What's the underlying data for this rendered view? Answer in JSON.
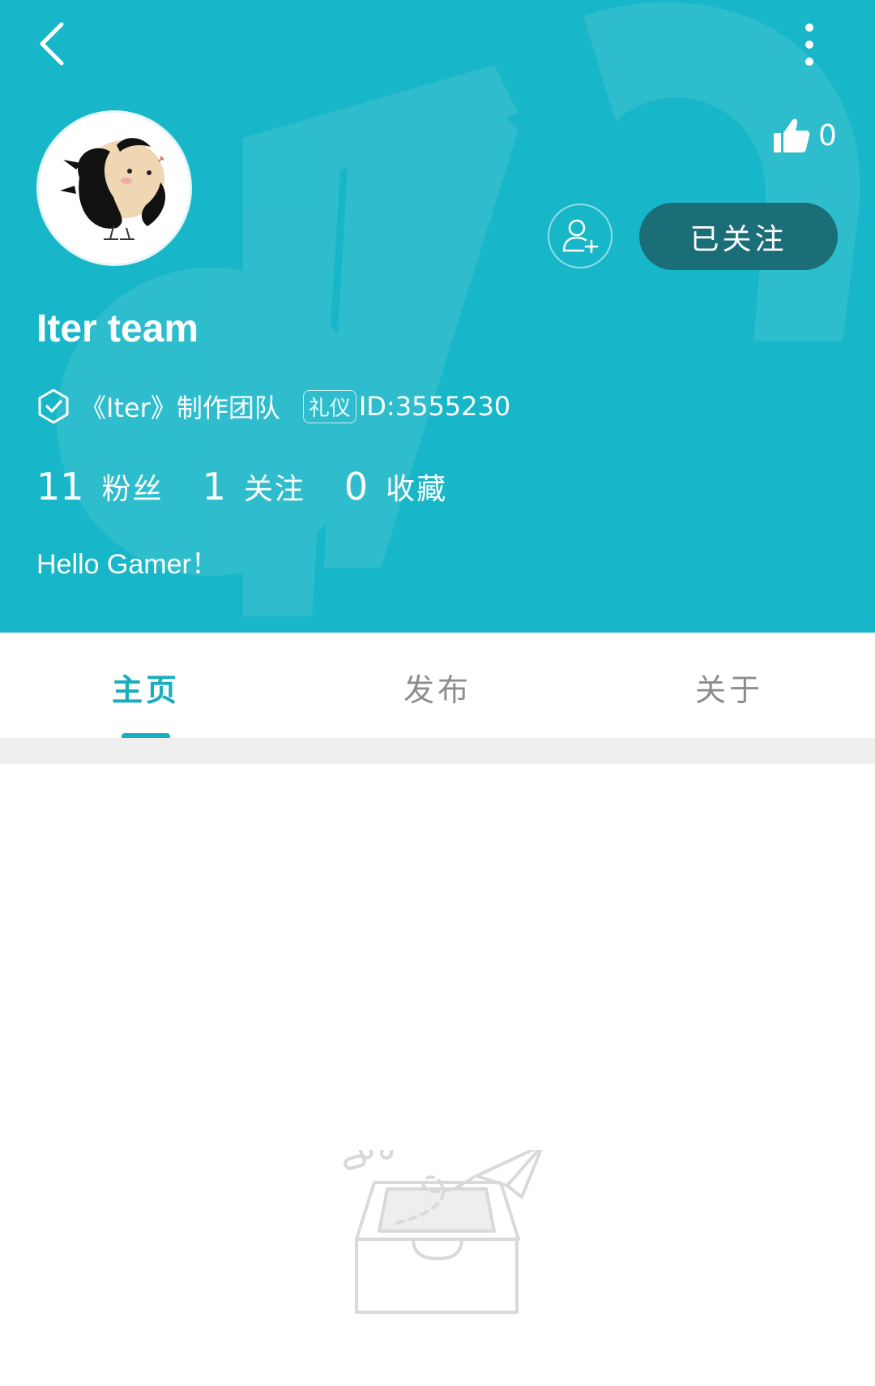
{
  "header": {
    "like_count": "0",
    "follow_button": "已关注",
    "username": "Iter team",
    "organization": "《Iter》制作团队",
    "tag": "礼仪",
    "user_id": "ID:3555230",
    "bio": "Hello Gamer！",
    "stats": [
      {
        "value": "11",
        "label": "粉丝"
      },
      {
        "value": "1",
        "label": "关注"
      },
      {
        "value": "0",
        "label": "收藏"
      }
    ],
    "colors": {
      "background": "#17b6c8",
      "follow_button": "#1b6d78"
    }
  },
  "icons": {
    "back": "chevron-left-icon",
    "more": "more-vertical-icon",
    "like": "thumbs-up-icon",
    "add_friend": "add-user-icon",
    "verified": "verified-shield-icon"
  },
  "tabs": [
    {
      "label": "主页",
      "active": true
    },
    {
      "label": "发布",
      "active": false
    },
    {
      "label": "关于",
      "active": false
    }
  ],
  "accent_color": "#19aebf"
}
